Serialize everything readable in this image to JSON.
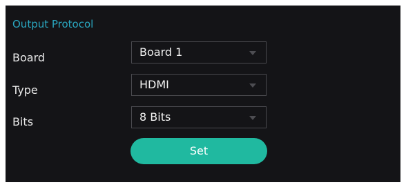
{
  "panel": {
    "title": "Output Protocol",
    "accent_color": "#2aa7c0",
    "background_color": "#141417"
  },
  "fields": {
    "board": {
      "label": "Board",
      "value": "Board 1"
    },
    "type": {
      "label": "Type",
      "value": "HDMI"
    },
    "bits": {
      "label": "Bits",
      "value": "8 Bits"
    }
  },
  "icons": {
    "dropdown": "chevron-down-icon"
  },
  "actions": {
    "set_label": "Set",
    "set_color": "#20b9a0"
  }
}
